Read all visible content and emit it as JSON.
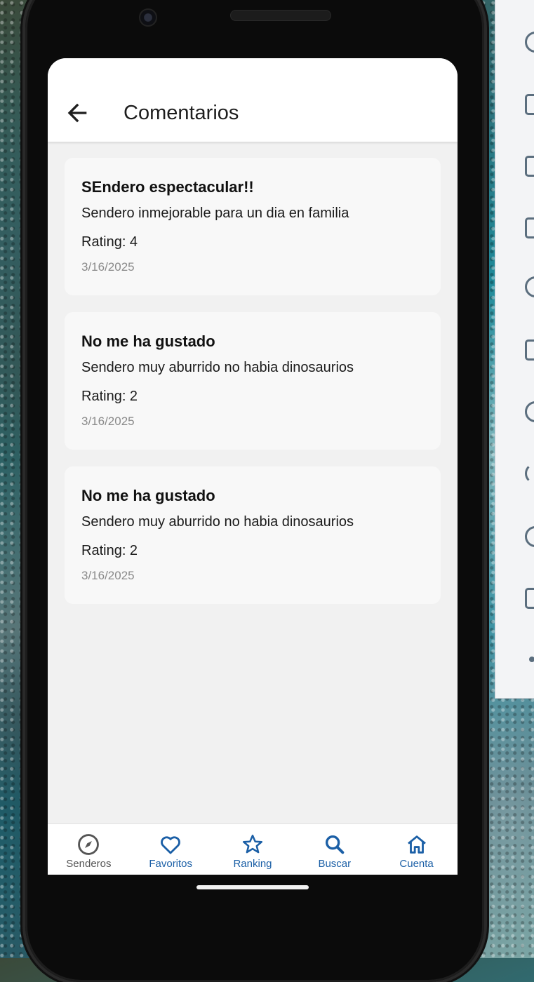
{
  "header": {
    "title": "Comentarios",
    "back_icon": "arrow-back-icon"
  },
  "comments": [
    {
      "title": "SEndero espectacular!!",
      "body": "Sendero inmejorable para un dia en familia",
      "rating": "Rating: 4",
      "date": "3/16/2025"
    },
    {
      "title": "No me ha gustado",
      "body": "Sendero muy aburrido no habia dinosaurios",
      "rating": "Rating: 2",
      "date": "3/16/2025"
    },
    {
      "title": "No me ha gustado",
      "body": "Sendero muy aburrido no habia dinosaurios",
      "rating": "Rating: 2",
      "date": "3/16/2025"
    }
  ],
  "nav": {
    "items": [
      {
        "label": "Senderos",
        "icon": "compass-icon"
      },
      {
        "label": "Favoritos",
        "icon": "heart-icon"
      },
      {
        "label": "Ranking",
        "icon": "star-icon"
      },
      {
        "label": "Buscar",
        "icon": "search-icon"
      },
      {
        "label": "Cuenta",
        "icon": "home-icon"
      }
    ]
  },
  "colors": {
    "accent": "#1b5fa6",
    "inactive": "#555555",
    "screen_bg": "#f1f1f1",
    "card_bg": "#f8f8f8"
  }
}
